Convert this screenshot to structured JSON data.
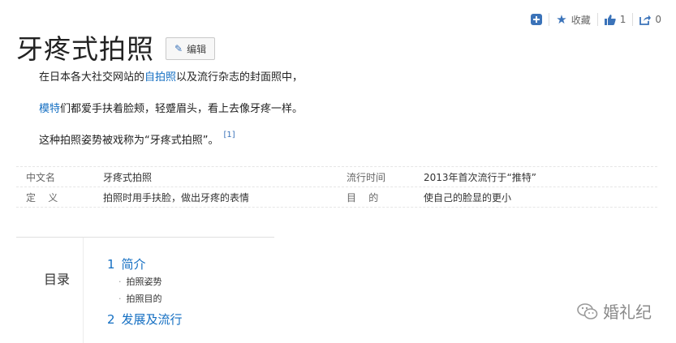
{
  "toolbar": {
    "collect_label": "收藏",
    "like_count": "1",
    "share_count": "0"
  },
  "title": "牙疼式拍照",
  "edit_label": "编辑",
  "intro": {
    "line1_before": "在日本各大社交网站的",
    "line1_link": "自拍照",
    "line1_after": "以及流行杂志的封面照中，",
    "line2_link": "模特",
    "line2_after": "们都爱手扶着脸颊，轻蹙眉头，看上去像牙疼一样。",
    "line3": "这种拍照姿势被戏称为“牙疼式拍照”。",
    "ref": "[1]"
  },
  "info": [
    {
      "k1": "中文名",
      "v1": "牙疼式拍照",
      "k2": "流行时间",
      "v2": "2013年首次流行于“推特”"
    },
    {
      "k1": "定    义",
      "v1": "拍照时用手扶脸，做出牙疼的表情",
      "k2": "目    的",
      "v2": "使自己的脸显的更小"
    }
  ],
  "toc": {
    "label": "目录",
    "items": [
      {
        "num": "1",
        "text": "简介"
      },
      {
        "num": "2",
        "text": "发展及流行"
      }
    ],
    "subs": [
      "拍照姿势",
      "拍照目的"
    ]
  },
  "watermark": "婚礼纪",
  "colors": {
    "accent": "#136ec2",
    "icon": "#3b73b9"
  }
}
